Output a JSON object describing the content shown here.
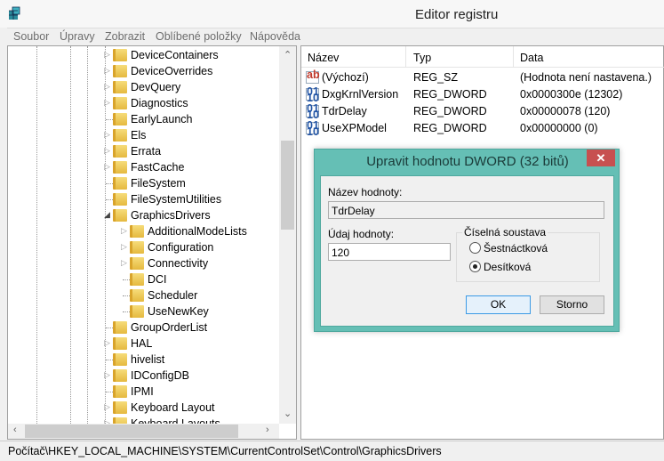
{
  "window": {
    "title": "Editor registru",
    "icon": "registry-editor-icon"
  },
  "menu": [
    "Soubor",
    "Úpravy",
    "Zobrazit",
    "Oblíbené položky",
    "Nápověda"
  ],
  "tree": [
    {
      "label": "DeviceContainers",
      "level": 1,
      "expander": "collapsed"
    },
    {
      "label": "DeviceOverrides",
      "level": 1,
      "expander": "collapsed"
    },
    {
      "label": "DevQuery",
      "level": 1,
      "expander": "collapsed"
    },
    {
      "label": "Diagnostics",
      "level": 1,
      "expander": "collapsed"
    },
    {
      "label": "EarlyLaunch",
      "level": 1,
      "expander": "none"
    },
    {
      "label": "Els",
      "level": 1,
      "expander": "collapsed"
    },
    {
      "label": "Errata",
      "level": 1,
      "expander": "collapsed"
    },
    {
      "label": "FastCache",
      "level": 1,
      "expander": "collapsed"
    },
    {
      "label": "FileSystem",
      "level": 1,
      "expander": "none"
    },
    {
      "label": "FileSystemUtilities",
      "level": 1,
      "expander": "none"
    },
    {
      "label": "GraphicsDrivers",
      "level": 1,
      "expander": "expanded",
      "selected": true
    },
    {
      "label": "AdditionalModeLists",
      "level": 2,
      "expander": "collapsed"
    },
    {
      "label": "Configuration",
      "level": 2,
      "expander": "collapsed"
    },
    {
      "label": "Connectivity",
      "level": 2,
      "expander": "collapsed"
    },
    {
      "label": "DCI",
      "level": 2,
      "expander": "none"
    },
    {
      "label": "Scheduler",
      "level": 2,
      "expander": "none"
    },
    {
      "label": "UseNewKey",
      "level": 2,
      "expander": "none"
    },
    {
      "label": "GroupOrderList",
      "level": 1,
      "expander": "none"
    },
    {
      "label": "HAL",
      "level": 1,
      "expander": "collapsed"
    },
    {
      "label": "hivelist",
      "level": 1,
      "expander": "none"
    },
    {
      "label": "IDConfigDB",
      "level": 1,
      "expander": "collapsed"
    },
    {
      "label": "IPMI",
      "level": 1,
      "expander": "none"
    },
    {
      "label": "Keyboard Layout",
      "level": 1,
      "expander": "collapsed"
    },
    {
      "label": "Keyboard Layouts",
      "level": 1,
      "expander": "collapsed"
    }
  ],
  "list": {
    "columns": [
      "Název",
      "Typ",
      "Data"
    ],
    "rows": [
      {
        "name": "(Výchozí)",
        "type": "REG_SZ",
        "data": "(Hodnota není nastavena.)",
        "icon": "string-value-icon"
      },
      {
        "name": "DxgKrnlVersion",
        "type": "REG_DWORD",
        "data": "0x0000300e (12302)",
        "icon": "binary-value-icon"
      },
      {
        "name": "TdrDelay",
        "type": "REG_DWORD",
        "data": "0x00000078 (120)",
        "icon": "binary-value-icon"
      },
      {
        "name": "UseXPModel",
        "type": "REG_DWORD",
        "data": "0x00000000 (0)",
        "icon": "binary-value-icon"
      }
    ]
  },
  "status": "Počítač\\HKEY_LOCAL_MACHINE\\SYSTEM\\CurrentControlSet\\Control\\GraphicsDrivers",
  "dialog": {
    "title": "Upravit hodnotu DWORD (32 bitů)",
    "close": "✕",
    "name_label": "Název hodnoty:",
    "name_value": "TdrDelay",
    "data_label": "Údaj hodnoty:",
    "data_value": "120",
    "base_label": "Číselná soustava",
    "hex_label": "Šestnáctková",
    "dec_label": "Desítková",
    "selected_base": "Desítková",
    "ok": "OK",
    "cancel": "Storno"
  },
  "colors": {
    "dialog_frame": "#65bfb5",
    "close_button": "#c75050"
  }
}
